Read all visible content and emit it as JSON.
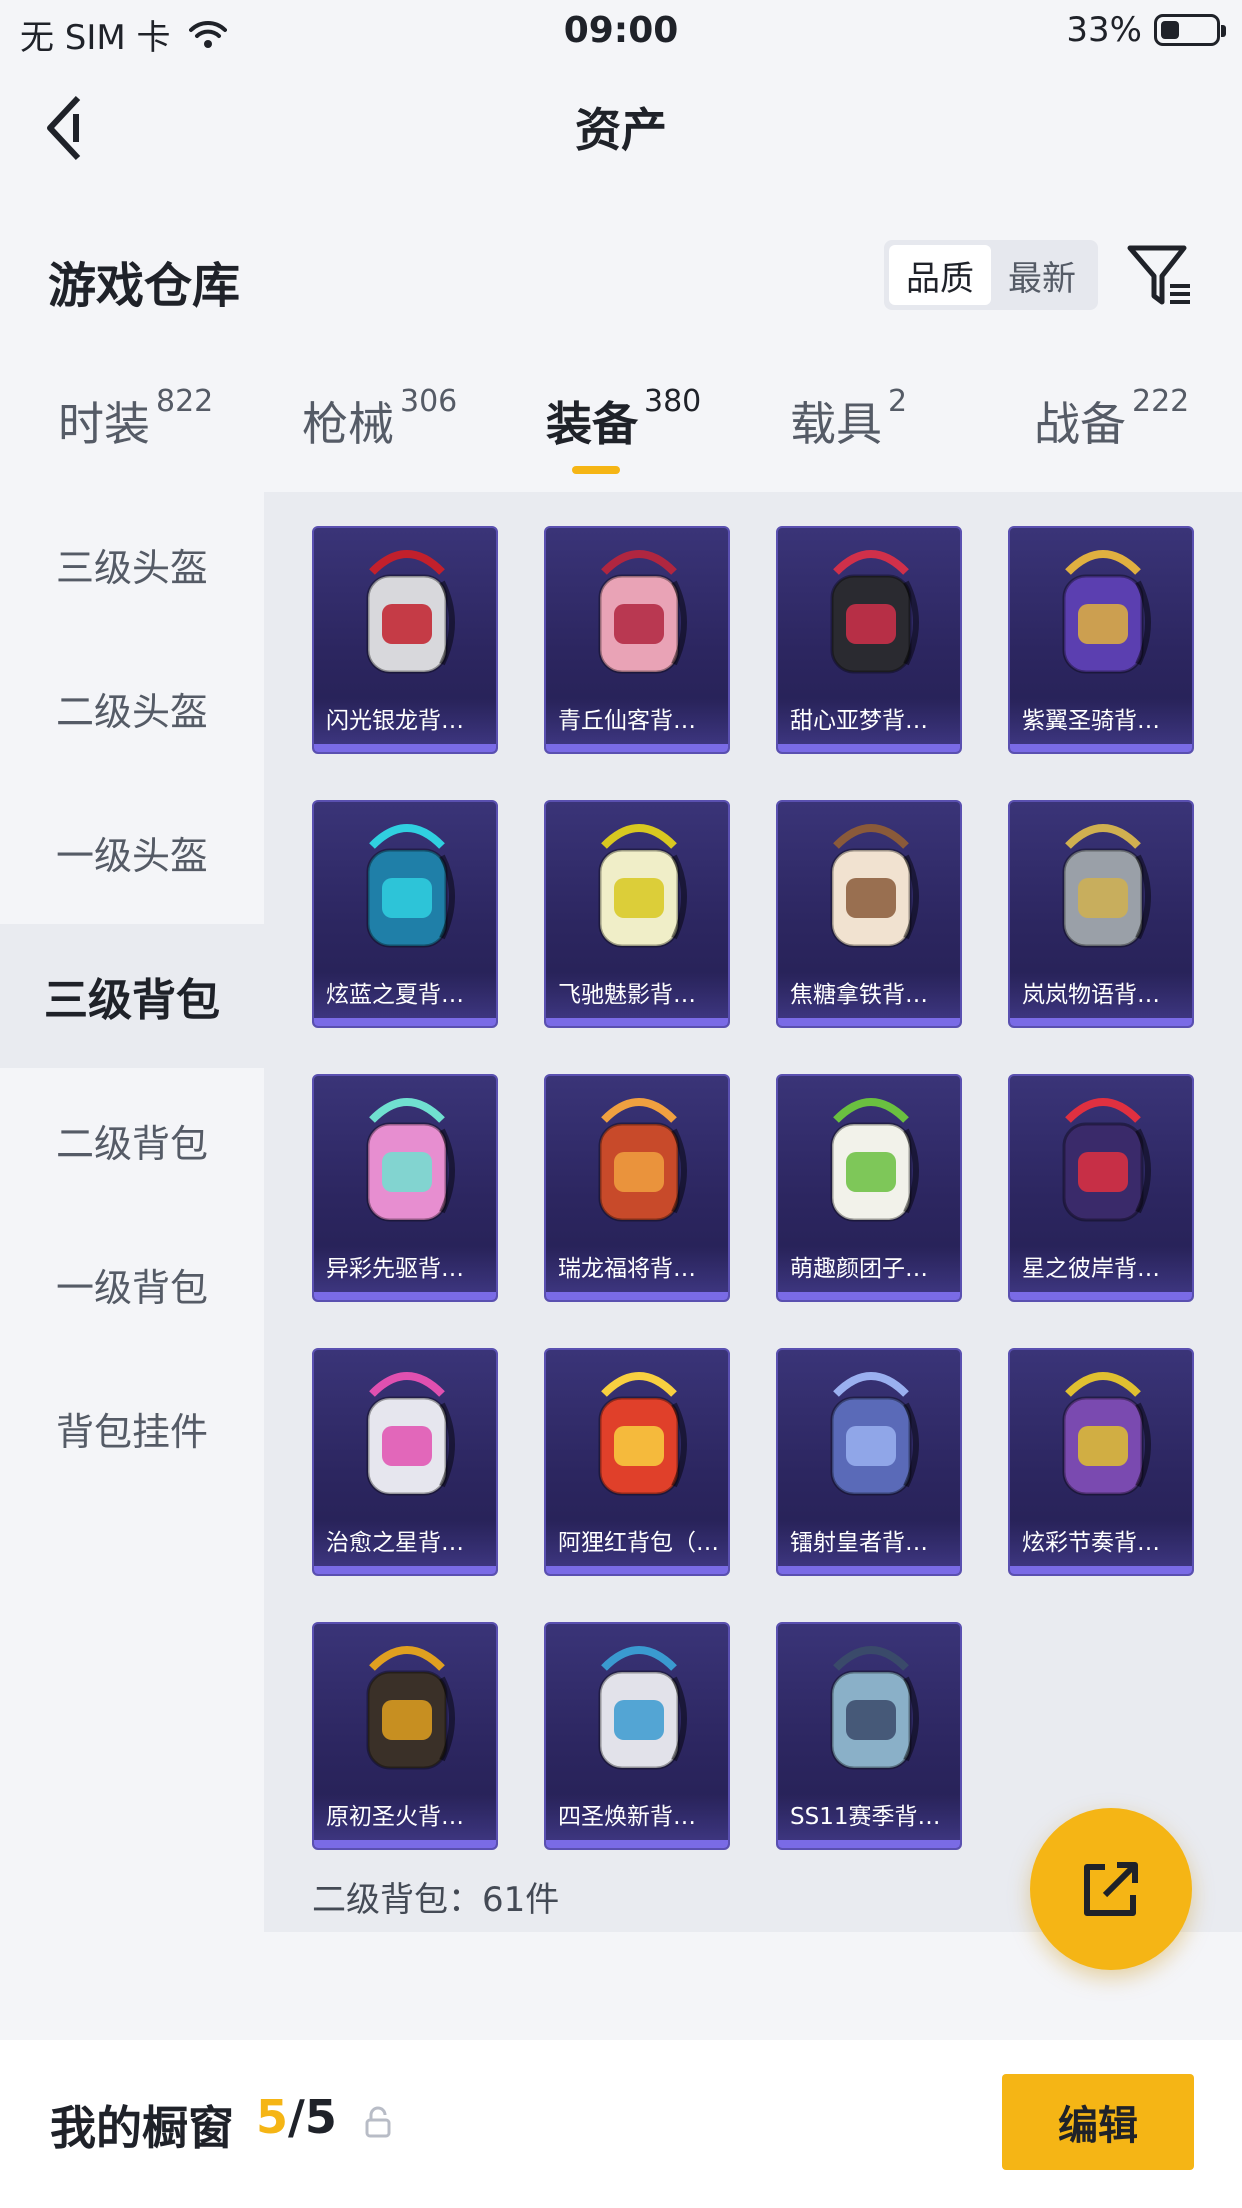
{
  "status_bar": {
    "carrier": "无 SIM 卡",
    "time": "09:00",
    "battery_percent": "33%",
    "battery_level": 0.33
  },
  "nav": {
    "title": "资产"
  },
  "section": {
    "title": "游戏仓库"
  },
  "sort": {
    "options": [
      "品质",
      "最新"
    ],
    "active": 0
  },
  "categories": [
    {
      "label": "时装",
      "count": "822"
    },
    {
      "label": "枪械",
      "count": "306"
    },
    {
      "label": "装备",
      "count": "380"
    },
    {
      "label": "载具",
      "count": "2"
    },
    {
      "label": "战备",
      "count": "222"
    }
  ],
  "active_category": 2,
  "sidebar": {
    "items": [
      "三级头盔",
      "二级头盔",
      "一级头盔",
      "三级背包",
      "二级背包",
      "一级背包",
      "背包挂件"
    ],
    "active": 3
  },
  "items": [
    {
      "name": "闪光银龙背…",
      "icon": "dragon-helmet-icon",
      "color": "#d8d8dc",
      "accent": "#c2202c"
    },
    {
      "name": "青丘仙客背…",
      "icon": "fox-backpack-icon",
      "color": "#e9a3b6",
      "accent": "#b02640"
    },
    {
      "name": "甜心亚梦背…",
      "icon": "quilted-backpack-icon",
      "color": "#2a2a30",
      "accent": "#d0304a"
    },
    {
      "name": "紫翼圣骑背…",
      "icon": "knight-backpack-icon",
      "color": "#5b3fb0",
      "accent": "#e0b040"
    },
    {
      "name": "炫蓝之夏背…",
      "icon": "summer-backpack-icon",
      "color": "#1f7fa8",
      "accent": "#30d0e0"
    },
    {
      "name": "飞驰魅影背…",
      "icon": "racer-backpack-icon",
      "color": "#f0eec8",
      "accent": "#d8c820"
    },
    {
      "name": "焦糖拿铁背…",
      "icon": "latte-backpack-icon",
      "color": "#f1e2d0",
      "accent": "#8a5a3a"
    },
    {
      "name": "岚岚物语背…",
      "icon": "crest-backpack-icon",
      "color": "#9aa0a8",
      "accent": "#d0b050"
    },
    {
      "name": "异彩先驱背…",
      "icon": "pastel-backpack-icon",
      "color": "#e78ed0",
      "accent": "#70e0d0"
    },
    {
      "name": "瑞龙福将背…",
      "icon": "dragon-warrior-icon",
      "color": "#c84a2a",
      "accent": "#f0a040"
    },
    {
      "name": "萌趣颜团子…",
      "icon": "mochi-backpack-icon",
      "color": "#f2f2ea",
      "accent": "#6ac040"
    },
    {
      "name": "星之彼岸背…",
      "icon": "astro-backpack-icon",
      "color": "#3a2a6a",
      "accent": "#e03040"
    },
    {
      "name": "治愈之星背…",
      "icon": "healing-star-icon",
      "color": "#e6e6ee",
      "accent": "#e050b0"
    },
    {
      "name": "阿狸红背包（…",
      "icon": "ahri-fox-icon",
      "color": "#e0402a",
      "accent": "#f8d040"
    },
    {
      "name": "镭射皇者背…",
      "icon": "laser-king-icon",
      "color": "#5a6ab8",
      "accent": "#9ab0f0"
    },
    {
      "name": "炫彩节奏背…",
      "icon": "graffiti-backpack-icon",
      "color": "#7a4ab0",
      "accent": "#e0c030"
    },
    {
      "name": "原初圣火背…",
      "icon": "flame-backpack-icon",
      "color": "#3a3028",
      "accent": "#e0a020"
    },
    {
      "name": "四圣焕新背…",
      "icon": "armor-backpack-icon",
      "color": "#e2e2ea",
      "accent": "#3a9ad0"
    },
    {
      "name": "SS11赛季背…",
      "icon": "season-backpack-icon",
      "color": "#8ab0c8",
      "accent": "#3a4a6a"
    }
  ],
  "count_line": "二级背包：61件",
  "fab": {
    "icon": "share-out-icon"
  },
  "bottom": {
    "label": "我的橱窗",
    "current": "5",
    "total": "/5",
    "edit_label": "编辑"
  }
}
